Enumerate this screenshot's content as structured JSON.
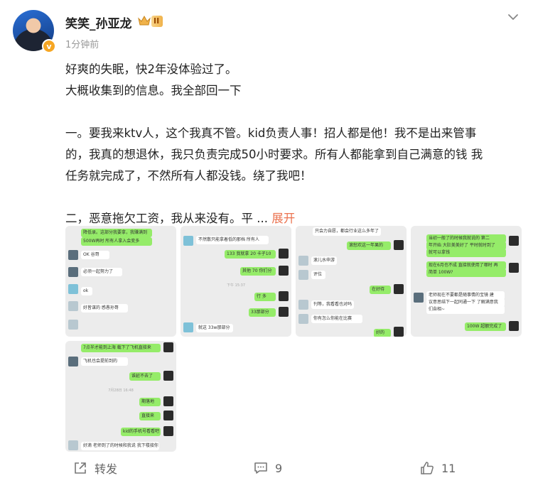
{
  "post": {
    "author": "笑笑_孙亚龙",
    "level_badge": "II",
    "avatar_badge": "v",
    "time": "1分钟前",
    "text_lines": [
      "好爽的失眠，快2年没体验过了。",
      "大概收集到的信息。我全部回一下",
      "",
      "一。要我来ktv人，这个我真不管。kid负责人事！招人都是他！我不是出来管事",
      "的，我真的想退休，我只负责完成50小时要求。所有人都能拿到自己满意的钱 我",
      "任务就完成了，不然所有人都没钱。绕了我吧！",
      "",
      "二，恶意拖欠工资，我从来没有。平 ... "
    ],
    "expand_label": "展开"
  },
  "images": {
    "img1": [
      "降低录。这部分我要拿，我赚满到",
      "500W再时 所有人拿入会变多",
      "OK 谷哥",
      "必须一起努力了",
      "ok",
      "好皆谋的 感愚孙哥"
    ],
    "img2": [
      "不然散只能拿着低的那档 所有人",
      "133 我就拿 20 卡子10",
      "其他 70 你们分",
      "行 多",
      "33那部分",
      "就这 33w那部分"
    ],
    "img3": [
      "只会力自愿，都会行业这么多年了",
      "滚愁欢这一年果的",
      "滚儿水申游",
      "评位",
      "在好待",
      "刊等，我看看也对吗",
      "你有怎么你能在比赛",
      "好的"
    ],
    "img4": [
      "当初一般了的时候我就说的 第二",
      "年开始 大肚美美好了 平时就时到了",
      "就可以拿钱",
      "现在6月也不成 直接就使用了哪时 再",
      "简单 100W?",
      "老师现在不要都是随事情的宝镜 建",
      "议意思结下一起同通一下 了解满意我",
      "们自相~",
      "100W 超额完成了"
    ],
    "img5": [
      "7点半才能到上海 载下了飞机直接来",
      "飞机也会提前到的",
      "谁延不去了",
      "期落地",
      "直接来",
      "kid的手机号看看吧",
      "好滴 老师到了的时候和我说 我下楼接你"
    ],
    "stamp1": "下午 15:37",
    "stamp2": "7月23日 11:45",
    "stamp3": "7月28日 16:48"
  },
  "footer": {
    "share_label": "转发",
    "comment_count": "9",
    "like_count": "11"
  },
  "colors": {
    "accent": "#eb7350",
    "chat_green": "#95ec69",
    "thumb_bg": "#ececec"
  }
}
